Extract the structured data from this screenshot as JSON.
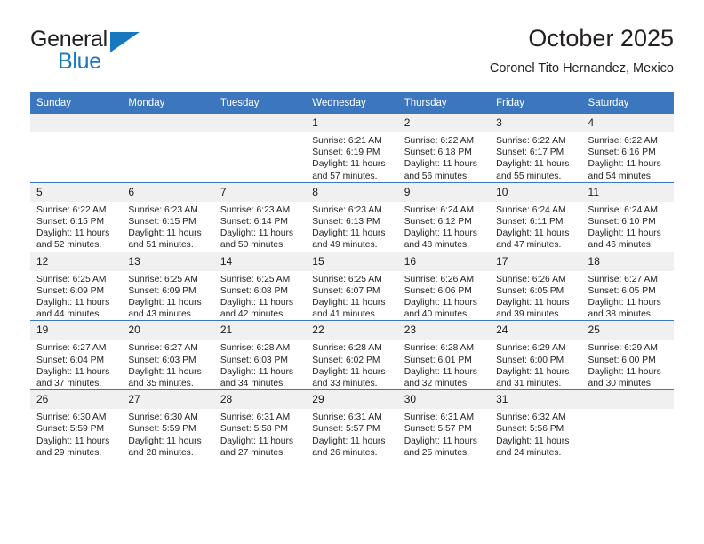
{
  "brand": {
    "name_top": "General",
    "name_bottom": "Blue",
    "triangle_color": "#1878BE"
  },
  "header": {
    "title": "October 2025",
    "subtitle": "Coronel Tito Hernandez, Mexico"
  },
  "theme": {
    "header_blue": "#3B76BF",
    "daynum_gray": "#F0F0F0",
    "text": "#231f20"
  },
  "calendar": {
    "weekday_headers": [
      "Sunday",
      "Monday",
      "Tuesday",
      "Wednesday",
      "Thursday",
      "Friday",
      "Saturday"
    ],
    "labels": {
      "sunrise": "Sunrise:",
      "sunset": "Sunset:",
      "daylight": "Daylight:"
    },
    "weeks": [
      [
        {
          "day": "",
          "empty": true
        },
        {
          "day": "",
          "empty": true
        },
        {
          "day": "",
          "empty": true
        },
        {
          "day": "1",
          "sunrise": "Sunrise: 6:21 AM",
          "sunset": "Sunset: 6:19 PM",
          "daylight": "Daylight: 11 hours and 57 minutes."
        },
        {
          "day": "2",
          "sunrise": "Sunrise: 6:22 AM",
          "sunset": "Sunset: 6:18 PM",
          "daylight": "Daylight: 11 hours and 56 minutes."
        },
        {
          "day": "3",
          "sunrise": "Sunrise: 6:22 AM",
          "sunset": "Sunset: 6:17 PM",
          "daylight": "Daylight: 11 hours and 55 minutes."
        },
        {
          "day": "4",
          "sunrise": "Sunrise: 6:22 AM",
          "sunset": "Sunset: 6:16 PM",
          "daylight": "Daylight: 11 hours and 54 minutes."
        }
      ],
      [
        {
          "day": "5",
          "sunrise": "Sunrise: 6:22 AM",
          "sunset": "Sunset: 6:15 PM",
          "daylight": "Daylight: 11 hours and 52 minutes."
        },
        {
          "day": "6",
          "sunrise": "Sunrise: 6:23 AM",
          "sunset": "Sunset: 6:15 PM",
          "daylight": "Daylight: 11 hours and 51 minutes."
        },
        {
          "day": "7",
          "sunrise": "Sunrise: 6:23 AM",
          "sunset": "Sunset: 6:14 PM",
          "daylight": "Daylight: 11 hours and 50 minutes."
        },
        {
          "day": "8",
          "sunrise": "Sunrise: 6:23 AM",
          "sunset": "Sunset: 6:13 PM",
          "daylight": "Daylight: 11 hours and 49 minutes."
        },
        {
          "day": "9",
          "sunrise": "Sunrise: 6:24 AM",
          "sunset": "Sunset: 6:12 PM",
          "daylight": "Daylight: 11 hours and 48 minutes."
        },
        {
          "day": "10",
          "sunrise": "Sunrise: 6:24 AM",
          "sunset": "Sunset: 6:11 PM",
          "daylight": "Daylight: 11 hours and 47 minutes."
        },
        {
          "day": "11",
          "sunrise": "Sunrise: 6:24 AM",
          "sunset": "Sunset: 6:10 PM",
          "daylight": "Daylight: 11 hours and 46 minutes."
        }
      ],
      [
        {
          "day": "12",
          "sunrise": "Sunrise: 6:25 AM",
          "sunset": "Sunset: 6:09 PM",
          "daylight": "Daylight: 11 hours and 44 minutes."
        },
        {
          "day": "13",
          "sunrise": "Sunrise: 6:25 AM",
          "sunset": "Sunset: 6:09 PM",
          "daylight": "Daylight: 11 hours and 43 minutes."
        },
        {
          "day": "14",
          "sunrise": "Sunrise: 6:25 AM",
          "sunset": "Sunset: 6:08 PM",
          "daylight": "Daylight: 11 hours and 42 minutes."
        },
        {
          "day": "15",
          "sunrise": "Sunrise: 6:25 AM",
          "sunset": "Sunset: 6:07 PM",
          "daylight": "Daylight: 11 hours and 41 minutes."
        },
        {
          "day": "16",
          "sunrise": "Sunrise: 6:26 AM",
          "sunset": "Sunset: 6:06 PM",
          "daylight": "Daylight: 11 hours and 40 minutes."
        },
        {
          "day": "17",
          "sunrise": "Sunrise: 6:26 AM",
          "sunset": "Sunset: 6:05 PM",
          "daylight": "Daylight: 11 hours and 39 minutes."
        },
        {
          "day": "18",
          "sunrise": "Sunrise: 6:27 AM",
          "sunset": "Sunset: 6:05 PM",
          "daylight": "Daylight: 11 hours and 38 minutes."
        }
      ],
      [
        {
          "day": "19",
          "sunrise": "Sunrise: 6:27 AM",
          "sunset": "Sunset: 6:04 PM",
          "daylight": "Daylight: 11 hours and 37 minutes."
        },
        {
          "day": "20",
          "sunrise": "Sunrise: 6:27 AM",
          "sunset": "Sunset: 6:03 PM",
          "daylight": "Daylight: 11 hours and 35 minutes."
        },
        {
          "day": "21",
          "sunrise": "Sunrise: 6:28 AM",
          "sunset": "Sunset: 6:03 PM",
          "daylight": "Daylight: 11 hours and 34 minutes."
        },
        {
          "day": "22",
          "sunrise": "Sunrise: 6:28 AM",
          "sunset": "Sunset: 6:02 PM",
          "daylight": "Daylight: 11 hours and 33 minutes."
        },
        {
          "day": "23",
          "sunrise": "Sunrise: 6:28 AM",
          "sunset": "Sunset: 6:01 PM",
          "daylight": "Daylight: 11 hours and 32 minutes."
        },
        {
          "day": "24",
          "sunrise": "Sunrise: 6:29 AM",
          "sunset": "Sunset: 6:00 PM",
          "daylight": "Daylight: 11 hours and 31 minutes."
        },
        {
          "day": "25",
          "sunrise": "Sunrise: 6:29 AM",
          "sunset": "Sunset: 6:00 PM",
          "daylight": "Daylight: 11 hours and 30 minutes."
        }
      ],
      [
        {
          "day": "26",
          "sunrise": "Sunrise: 6:30 AM",
          "sunset": "Sunset: 5:59 PM",
          "daylight": "Daylight: 11 hours and 29 minutes."
        },
        {
          "day": "27",
          "sunrise": "Sunrise: 6:30 AM",
          "sunset": "Sunset: 5:59 PM",
          "daylight": "Daylight: 11 hours and 28 minutes."
        },
        {
          "day": "28",
          "sunrise": "Sunrise: 6:31 AM",
          "sunset": "Sunset: 5:58 PM",
          "daylight": "Daylight: 11 hours and 27 minutes."
        },
        {
          "day": "29",
          "sunrise": "Sunrise: 6:31 AM",
          "sunset": "Sunset: 5:57 PM",
          "daylight": "Daylight: 11 hours and 26 minutes."
        },
        {
          "day": "30",
          "sunrise": "Sunrise: 6:31 AM",
          "sunset": "Sunset: 5:57 PM",
          "daylight": "Daylight: 11 hours and 25 minutes."
        },
        {
          "day": "31",
          "sunrise": "Sunrise: 6:32 AM",
          "sunset": "Sunset: 5:56 PM",
          "daylight": "Daylight: 11 hours and 24 minutes."
        },
        {
          "day": "",
          "empty": true
        }
      ]
    ]
  }
}
